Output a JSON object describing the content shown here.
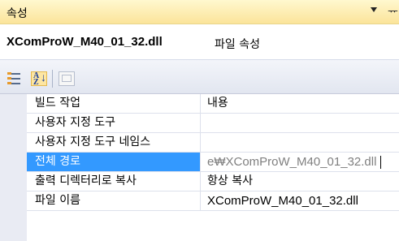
{
  "titlebar": {
    "title": "속성",
    "dropdown_icon": "chevron-down-icon",
    "pin_glyph": "ᅲ",
    "pin_icon": "pushpin-icon"
  },
  "object": {
    "name": "XComProW_M40_01_32.dll",
    "type": "파일 속성"
  },
  "toolbar": {
    "buttons": [
      {
        "icon": "categorized-icon"
      },
      {
        "icon": "alphabetical-sort-icon",
        "active": true
      },
      {
        "icon": "property-pages-icon",
        "enabled": false
      }
    ]
  },
  "properties": [
    {
      "name": "빌드 작업",
      "value": "내용"
    },
    {
      "name": "사용자 지정 도구",
      "value": ""
    },
    {
      "name": "사용자 지정 도구 네임스",
      "value": ""
    },
    {
      "name": "전체 경로",
      "value": "e₩XComProW_M40_01_32.dll",
      "selected": true
    },
    {
      "name": "출력 디렉터리로 복사",
      "value": "항상 복사"
    },
    {
      "name": "파일 이름",
      "value": "XComProW_M40_01_32.dll"
    }
  ],
  "colors": {
    "selection": "#3399ff",
    "titlebar": "#fbe49a",
    "gutter": "#e9ebf3"
  }
}
